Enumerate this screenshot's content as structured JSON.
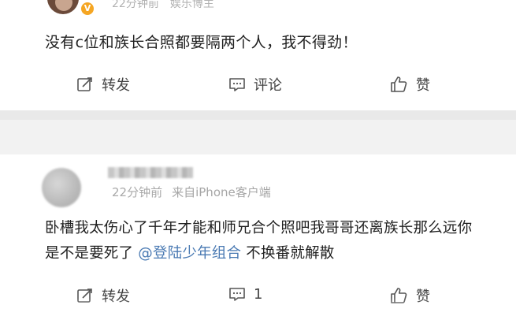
{
  "post1": {
    "time": "22分钟前",
    "source": "娱乐博主",
    "verified_badge": "V",
    "text": "没有c位和族长合照都要隔两个人，我不得劲！",
    "actions": {
      "forward": "转发",
      "comment": "评论",
      "like": "赞"
    }
  },
  "post2": {
    "time": "22分钟前",
    "source": "来自iPhone客户端",
    "text_before": "卧槽我太伤心了千年才能和师兄合个照吧我哥哥还离族长那么远你是不是要死了",
    "mention": "@登陆少年组合",
    "text_after": " 不换番就解散",
    "actions": {
      "forward": "转发",
      "comment_count": "1",
      "like": "赞"
    }
  },
  "icons": {
    "forward": "edit-share-icon",
    "comment": "comment-bubble-icon",
    "like": "thumbs-up-icon"
  },
  "colors": {
    "mention": "#4a7ab3",
    "separator": "#f2f2f2",
    "meta": "#a9a9a9"
  }
}
